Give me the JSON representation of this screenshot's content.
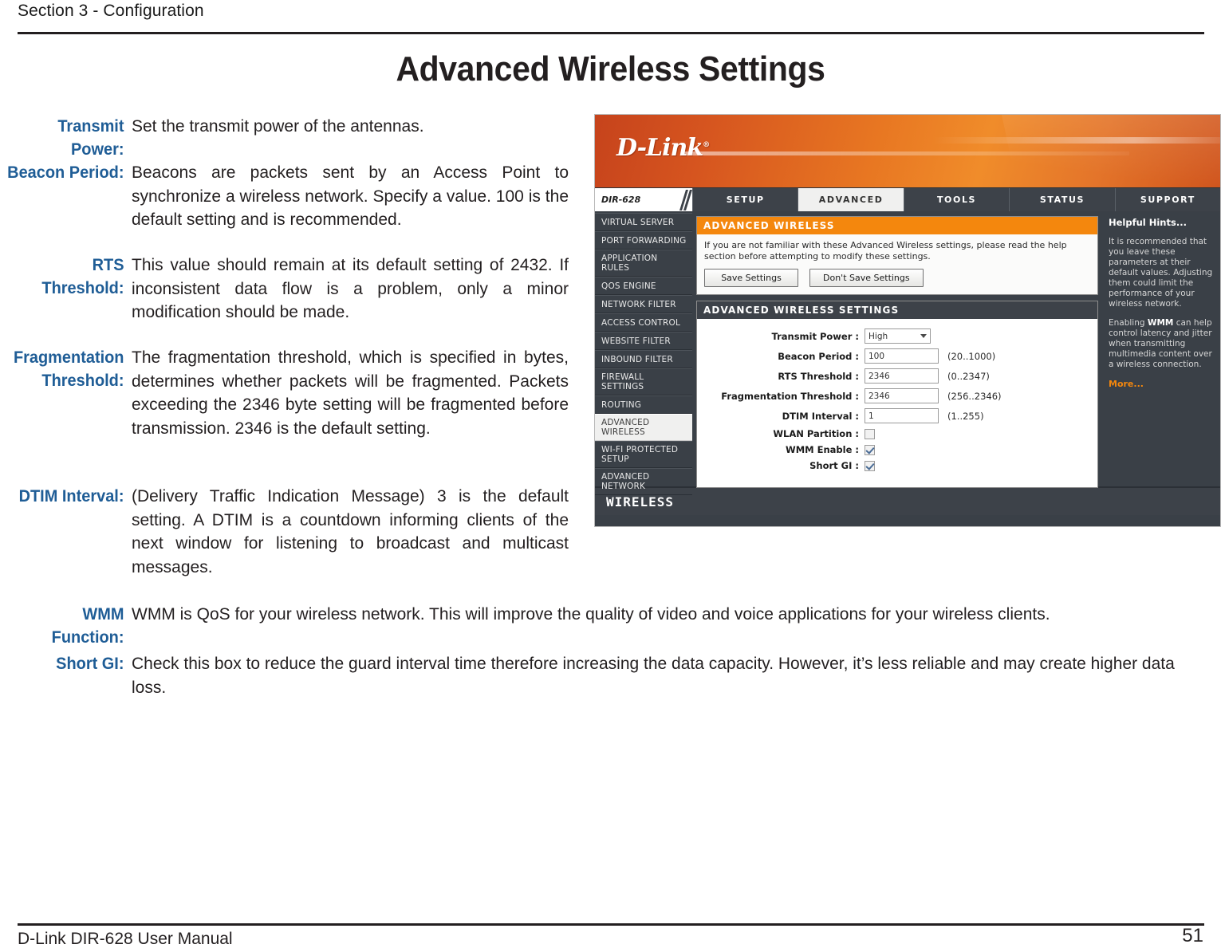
{
  "page": {
    "section_label": "Section 3 - Configuration",
    "title": "Advanced Wireless Settings",
    "footer_left": "D-Link DIR-628 User Manual",
    "footer_page": "51",
    "accent_blue": "#1f5d96",
    "accent_orange": "#f4870d"
  },
  "descriptions": [
    {
      "label": "Transmit Power:",
      "body": "Set the transmit power of the antennas."
    },
    {
      "label": "Beacon Period:",
      "body": "Beacons are packets sent by an Access Point to synchronize a wireless network. Specify a value. 100 is the default setting and is recommended."
    },
    {
      "label": "RTS Threshold:",
      "body": "This value should remain at its default setting of 2432. If inconsistent data flow is a problem, only a minor modification should be made."
    },
    {
      "label": "Fragmentation Threshold:",
      "body": "The fragmentation threshold, which is specified in bytes, determines whether packets will be fragmented. Packets exceeding the 2346 byte setting will be fragmented before transmission. 2346 is the default setting."
    },
    {
      "label": "DTIM Interval:",
      "body": "(Delivery Traffic Indication Message) 3 is the default setting. A DTIM is a countdown informing clients of the next window for listening to broadcast and multicast messages."
    },
    {
      "label": "WMM Function:",
      "body": "WMM is QoS for your wireless network. This will improve the quality of video and voice applications for your wireless clients."
    },
    {
      "label": "Short GI:",
      "body": "Check this box to reduce the guard interval time therefore increasing the data capacity.  However, it’s less reliable and may create higher data loss."
    }
  ],
  "router_ui": {
    "brand": "D-Link",
    "brand_mark": "®",
    "model": "DIR-628",
    "nav": [
      {
        "label": "SETUP",
        "active": false
      },
      {
        "label": "ADVANCED",
        "active": true
      },
      {
        "label": "TOOLS",
        "active": false
      },
      {
        "label": "STATUS",
        "active": false
      },
      {
        "label": "SUPPORT",
        "active": false
      }
    ],
    "sidebar": [
      {
        "label": "VIRTUAL SERVER",
        "active": false
      },
      {
        "label": "PORT FORWARDING",
        "active": false
      },
      {
        "label": "APPLICATION RULES",
        "active": false
      },
      {
        "label": "QOS ENGINE",
        "active": false
      },
      {
        "label": "NETWORK FILTER",
        "active": false
      },
      {
        "label": "ACCESS CONTROL",
        "active": false
      },
      {
        "label": "WEBSITE FILTER",
        "active": false
      },
      {
        "label": "INBOUND FILTER",
        "active": false
      },
      {
        "label": "FIREWALL SETTINGS",
        "active": false
      },
      {
        "label": "ROUTING",
        "active": false
      },
      {
        "label": "ADVANCED WIRELESS",
        "active": true
      },
      {
        "label": "WI-FI PROTECTED SETUP",
        "active": false
      },
      {
        "label": "ADVANCED NETWORK",
        "active": false
      }
    ],
    "info_panel": {
      "title": "ADVANCED WIRELESS",
      "description": "If you are not familiar with these Advanced Wireless settings, please read the help section before attempting to modify these settings.",
      "save_label": "Save Settings",
      "dont_save_label": "Don't Save Settings"
    },
    "settings_panel": {
      "title": "ADVANCED WIRELESS SETTINGS",
      "fields": [
        {
          "label": "Transmit Power :",
          "type": "select",
          "value": "High",
          "hint": ""
        },
        {
          "label": "Beacon Period :",
          "type": "text",
          "value": "100",
          "hint": "(20..1000)"
        },
        {
          "label": "RTS Threshold :",
          "type": "text",
          "value": "2346",
          "hint": "(0..2347)"
        },
        {
          "label": "Fragmentation Threshold :",
          "type": "text",
          "value": "2346",
          "hint": "(256..2346)"
        },
        {
          "label": "DTIM Interval :",
          "type": "text",
          "value": "1",
          "hint": "(1..255)"
        },
        {
          "label": "WLAN Partition :",
          "type": "checkbox",
          "value": "unchecked",
          "hint": ""
        },
        {
          "label": "WMM Enable :",
          "type": "checkbox",
          "value": "checked",
          "hint": ""
        },
        {
          "label": "Short GI :",
          "type": "checkbox",
          "value": "checked",
          "hint": ""
        }
      ]
    },
    "hints": {
      "title": "Helpful Hints...",
      "p1": "It is recommended that you leave these parameters at their default values. Adjusting them could limit the performance of your wireless network.",
      "p2_before": "Enabling ",
      "p2_bold": "WMM",
      "p2_after": " can help control latency and jitter when transmitting multimedia content over a wireless connection.",
      "more_label": "More..."
    },
    "footer_label": "WIRELESS"
  }
}
